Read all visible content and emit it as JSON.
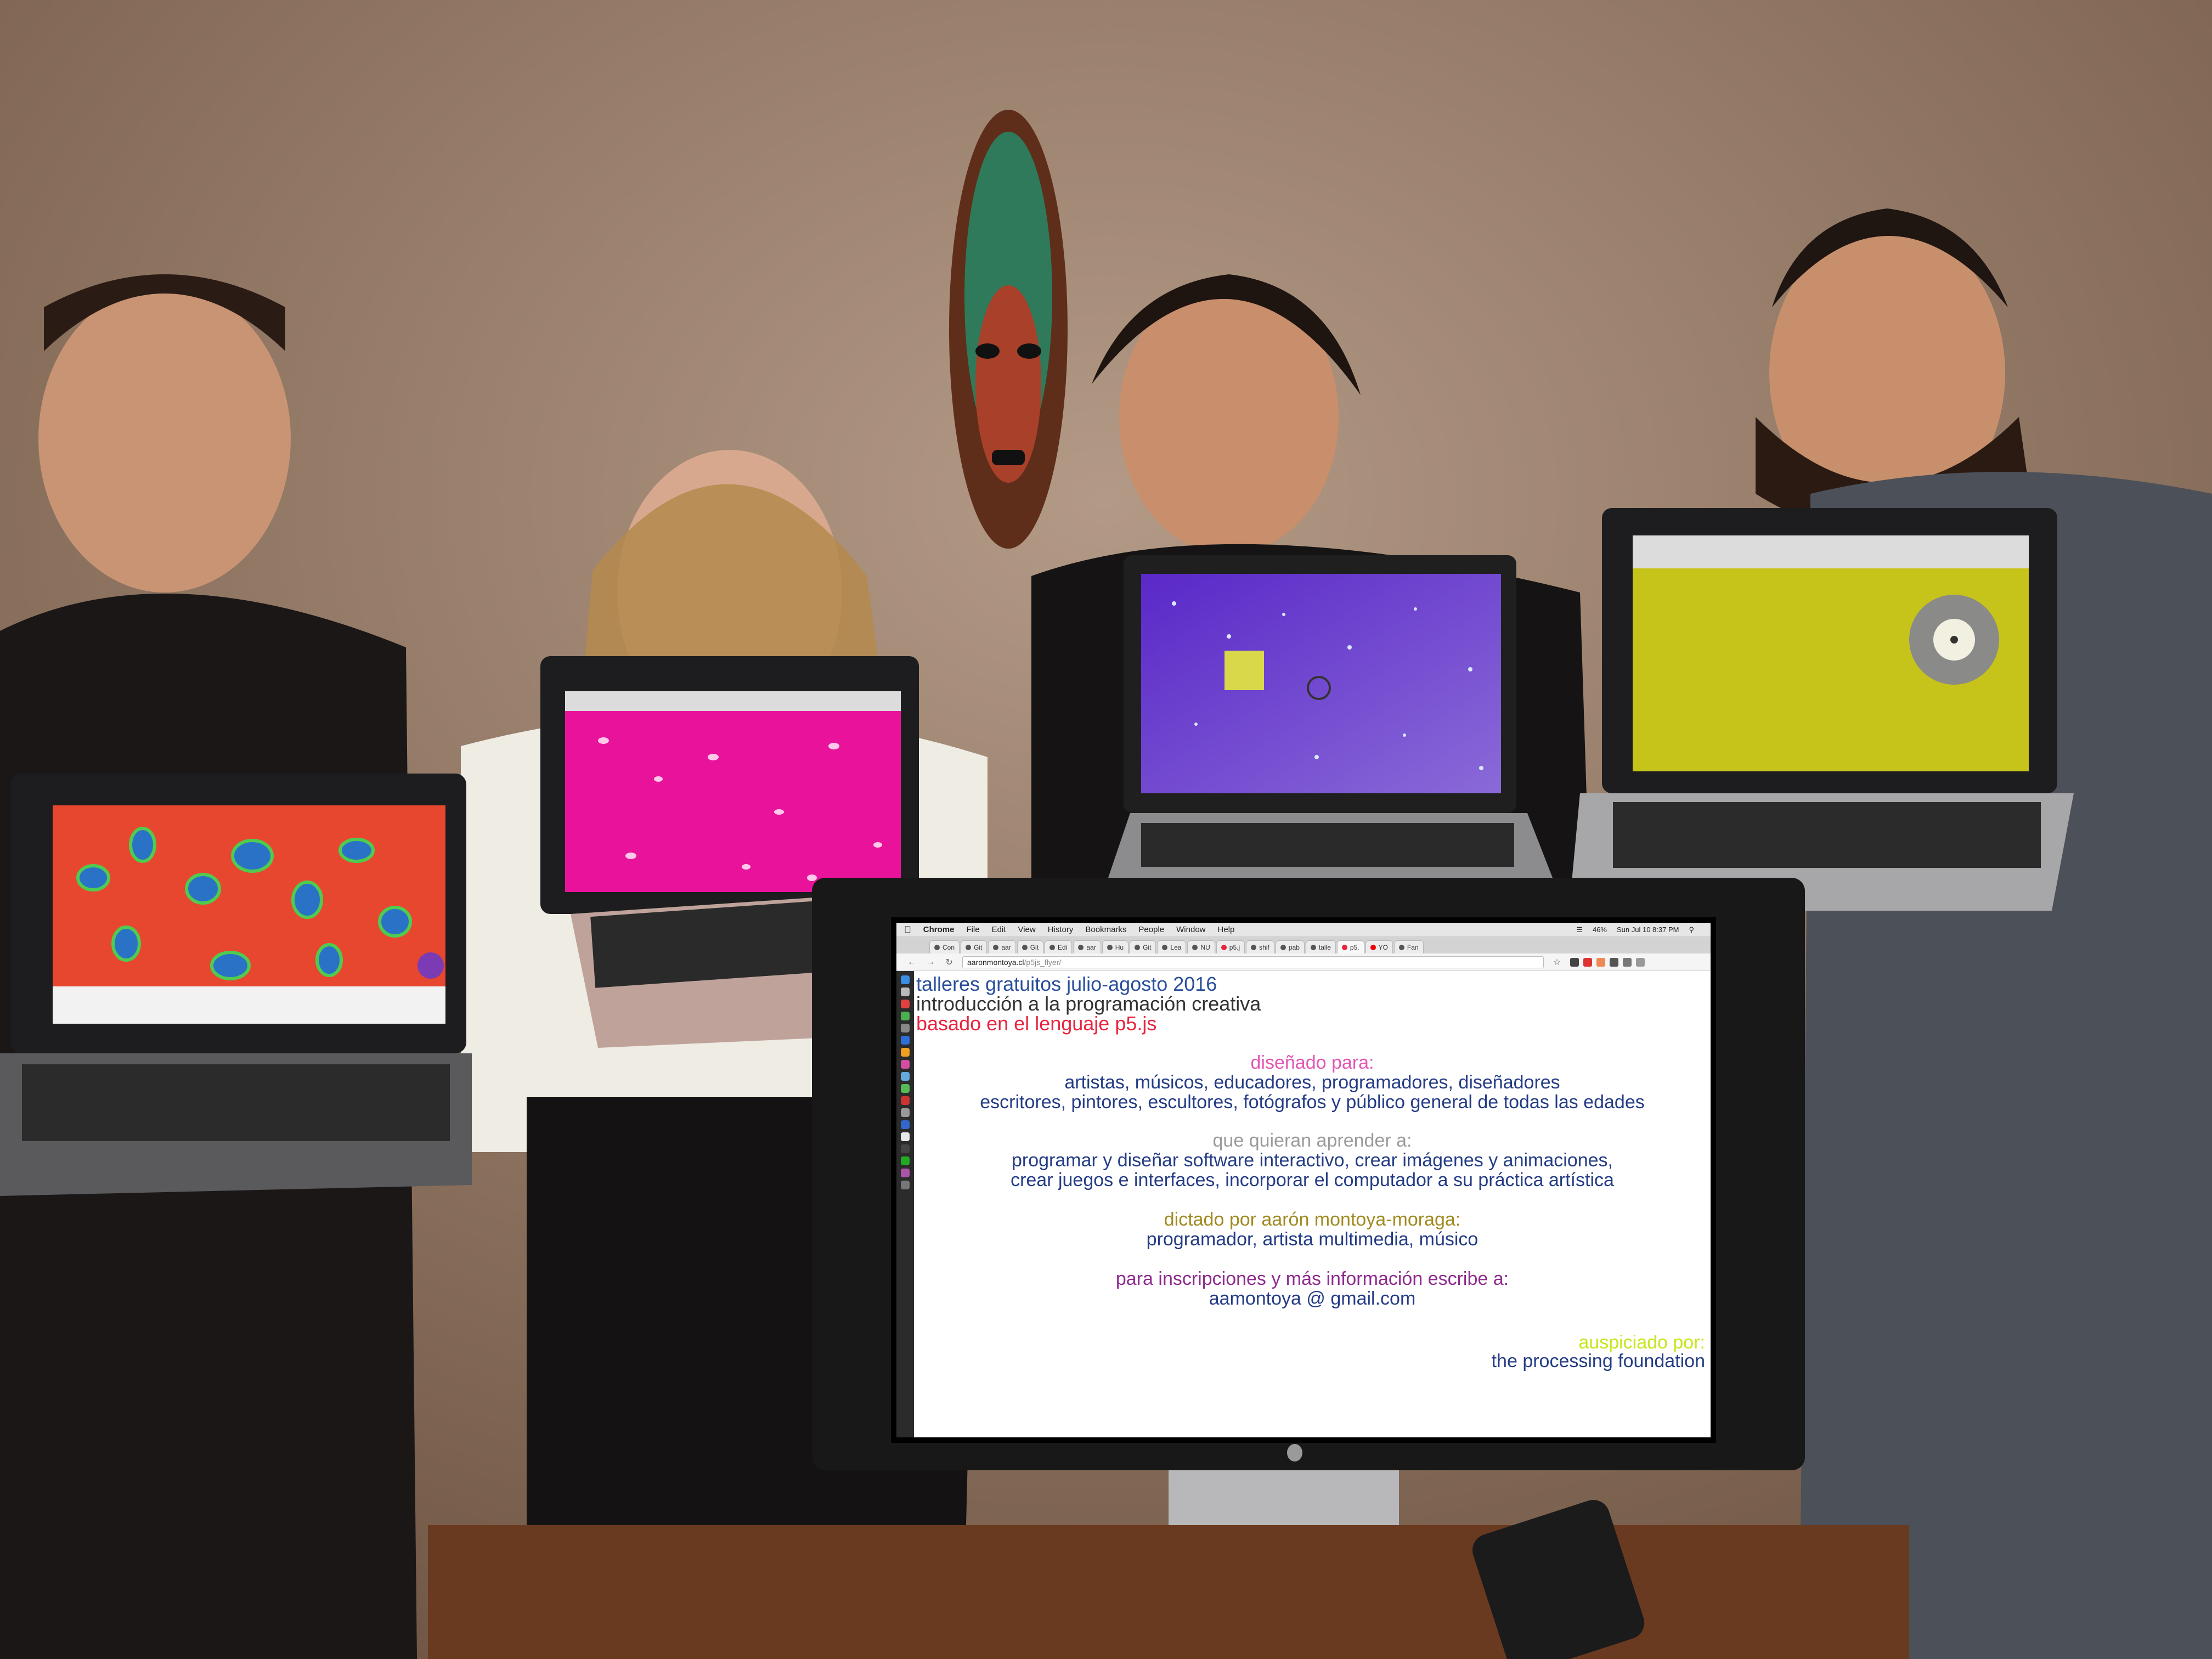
{
  "colors": {
    "blue": "#2a4f9b",
    "dark": "#333333",
    "red": "#e8243f",
    "pink": "#e356b5",
    "navy": "#243c86",
    "gray": "#9a9a9a",
    "olive": "#a08a20",
    "purple": "#8e2a8e",
    "lime": "#c7e61a"
  },
  "menubar": {
    "apple_icon": "apple-icon",
    "items": [
      "Chrome",
      "File",
      "Edit",
      "View",
      "History",
      "Bookmarks",
      "People",
      "Window",
      "Help"
    ],
    "status": {
      "battery": "46%",
      "clock": "Sun Jul 10  8:37 PM"
    }
  },
  "browser": {
    "tabs": [
      "Con",
      "Git",
      "aar",
      "Git",
      "Edi",
      "aar",
      "Hu",
      "Git",
      "Lea",
      "NU",
      "p5.j",
      "shif",
      "pab",
      "talle",
      "p5.",
      "YO",
      "Fan"
    ],
    "url": {
      "host": "aaronmontoya.cl",
      "path": "/p5js_flyer/"
    }
  },
  "flyer": {
    "title": "talleres gratuitos julio-agosto 2016",
    "subtitle": "introducción a la programación creativa",
    "language": "basado en el lenguaje p5.js",
    "designed_for": {
      "label": "diseñado para:",
      "lines": [
        "artistas, músicos, educadores, programadores, diseñadores",
        "escritores, pintores, escultores, fotógrafos y público general de todas las edades"
      ]
    },
    "want_to_learn": {
      "label": "que quieran aprender a:",
      "lines": [
        "programar y diseñar software interactivo, crear imágenes y animaciones,",
        "crear juegos e interfaces, incorporar el computador a su práctica artística"
      ]
    },
    "taught_by": {
      "label": "dictado por aarón montoya-moraga:",
      "line": "programador, artista multimedia, músico"
    },
    "contact": {
      "label": "para inscripciones y más información escribe a:",
      "email": "aamontoya @ gmail.com"
    },
    "sponsor": {
      "label": "auspiciado por:",
      "name": "the processing foundation"
    }
  },
  "laptop_sketches": [
    "red-ellipses-sketch",
    "pink-particles-sketch",
    "purple-stars-sketch",
    "yellow-vinyl-sketch"
  ]
}
